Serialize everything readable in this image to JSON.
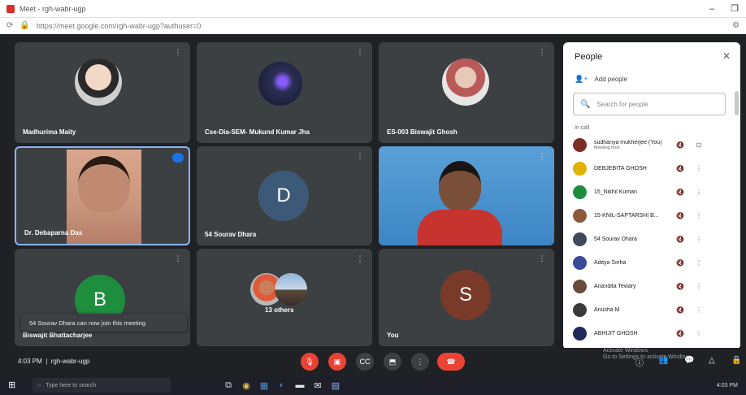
{
  "browser": {
    "tab_title": "Meet - rgh-wabr-ugp",
    "url": "https://meet.google.com/rgh-wabr-ugp?authuser=0"
  },
  "tiles": [
    {
      "name": "Madhurima Maity",
      "type": "photo",
      "avatar_color": "#c9a27e"
    },
    {
      "name": "Cse-Dia-SEM- Mukund Kumar Jha",
      "type": "photo",
      "avatar_color": "#2b2f55"
    },
    {
      "name": "ES-003 Biswajit Ghosh",
      "type": "photo",
      "avatar_color": "#b85a5a"
    },
    {
      "name": "Dr. Debaparna Das",
      "type": "video",
      "active": true
    },
    {
      "name": "54 Sourav Dhara",
      "type": "letter",
      "letter": "D",
      "avatar_color": "#3c5a78"
    },
    {
      "name": "",
      "type": "video"
    },
    {
      "name": "Biswajit Bhattacharjee",
      "type": "letter",
      "letter": "B",
      "avatar_color": "#1e8e3e"
    },
    {
      "name": "13 others",
      "type": "group"
    },
    {
      "name": "You",
      "type": "letter",
      "letter": "S",
      "avatar_color": "#7a3a2a"
    }
  ],
  "toast": "54 Sourav Dhara can now join this meeting",
  "people_panel": {
    "title": "People",
    "add_people": "Add people",
    "search_placeholder": "Search for people",
    "section": "In call",
    "people": [
      {
        "name": "sudhanya mukherjee (You)",
        "sub": "Meeting host",
        "color": "#7b2d26"
      },
      {
        "name": "DEBJEBITA GHOSH",
        "sub": "",
        "color": "#e3b100"
      },
      {
        "name": "15_Nikhil Kumari",
        "sub": "",
        "color": "#1e8e3e"
      },
      {
        "name": "15-KNIL-SAPTARSHI B...",
        "sub": "",
        "color": "#8a5a3a"
      },
      {
        "name": "54 Sourav Dhara",
        "sub": "",
        "color": "#3c4a5a"
      },
      {
        "name": "Aditya Sinha",
        "sub": "",
        "color": "#3a4a9a"
      },
      {
        "name": "Anandita Tewary",
        "sub": "",
        "color": "#6a4a3a"
      },
      {
        "name": "Anusha M",
        "sub": "",
        "color": "#3a3a3a"
      },
      {
        "name": "ABHIJIT GHOSH",
        "sub": "",
        "color": "#1f2a5a"
      }
    ]
  },
  "meetbar": {
    "time": "4:03 PM",
    "meeting_code": "rgh-wabr-ugp",
    "activate_line1": "Activate Windows",
    "activate_line2": "Go to Settings to activate Windows."
  },
  "taskbar": {
    "search_placeholder": "Type here to search",
    "clock": "4:03 PM"
  },
  "icons": {
    "tab_favicon": "meet-icon",
    "mic": "mic-off-icon",
    "cam": "videocam-off-icon",
    "cc": "captions-icon",
    "present": "present-icon",
    "more": "more-vert-icon",
    "end": "call-end-icon"
  }
}
